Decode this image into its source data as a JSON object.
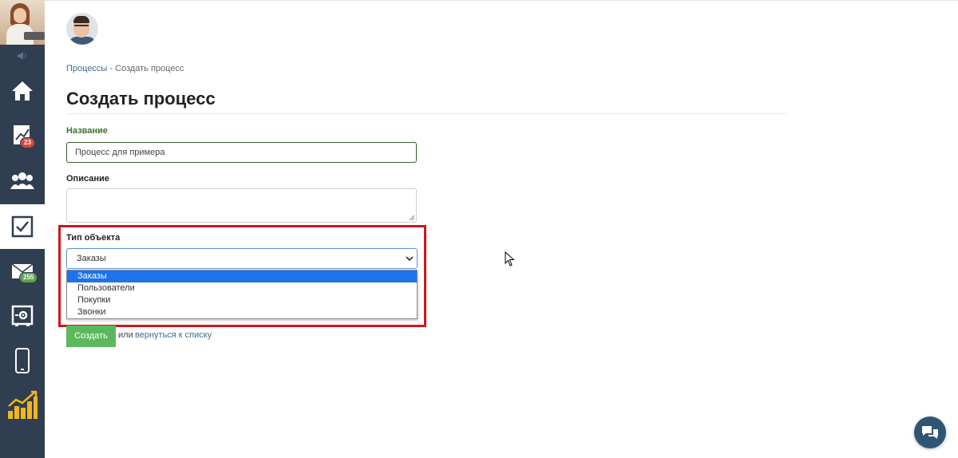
{
  "sidebar": {
    "items": [
      {
        "icon": "home-icon"
      },
      {
        "icon": "deals-chart-icon",
        "badge": "23",
        "badge_color": "#d9463f"
      },
      {
        "icon": "users-group-icon"
      },
      {
        "icon": "checkbox-tasks-icon",
        "active": true
      },
      {
        "icon": "mail-icon",
        "badge": "255",
        "badge_color": "#5ea34e"
      },
      {
        "icon": "settings-box-icon"
      },
      {
        "icon": "mobile-icon"
      },
      {
        "icon": "analytics-bars-icon"
      }
    ],
    "background": "#2f3e50"
  },
  "breadcrumb": {
    "parent": "Процессы",
    "separator": " - ",
    "current": "Создать процесс"
  },
  "page": {
    "title": "Создать процесс"
  },
  "form": {
    "name_label": "Название",
    "name_value": "Процесс для примера",
    "description_label": "Описание",
    "description_value": "",
    "object_type_label": "Тип объекта",
    "object_type_selected": "Заказы",
    "object_type_options": [
      "Заказы",
      "Пользователи",
      "Покупки",
      "Звонки"
    ],
    "submit_label": "Создать",
    "or_text": "или",
    "back_link": "вернуться к списку"
  },
  "colors": {
    "accent_green": "#5cb85c",
    "highlight_red": "#d0161b",
    "link_blue": "#41688f",
    "option_selected": "#1e73e8"
  }
}
